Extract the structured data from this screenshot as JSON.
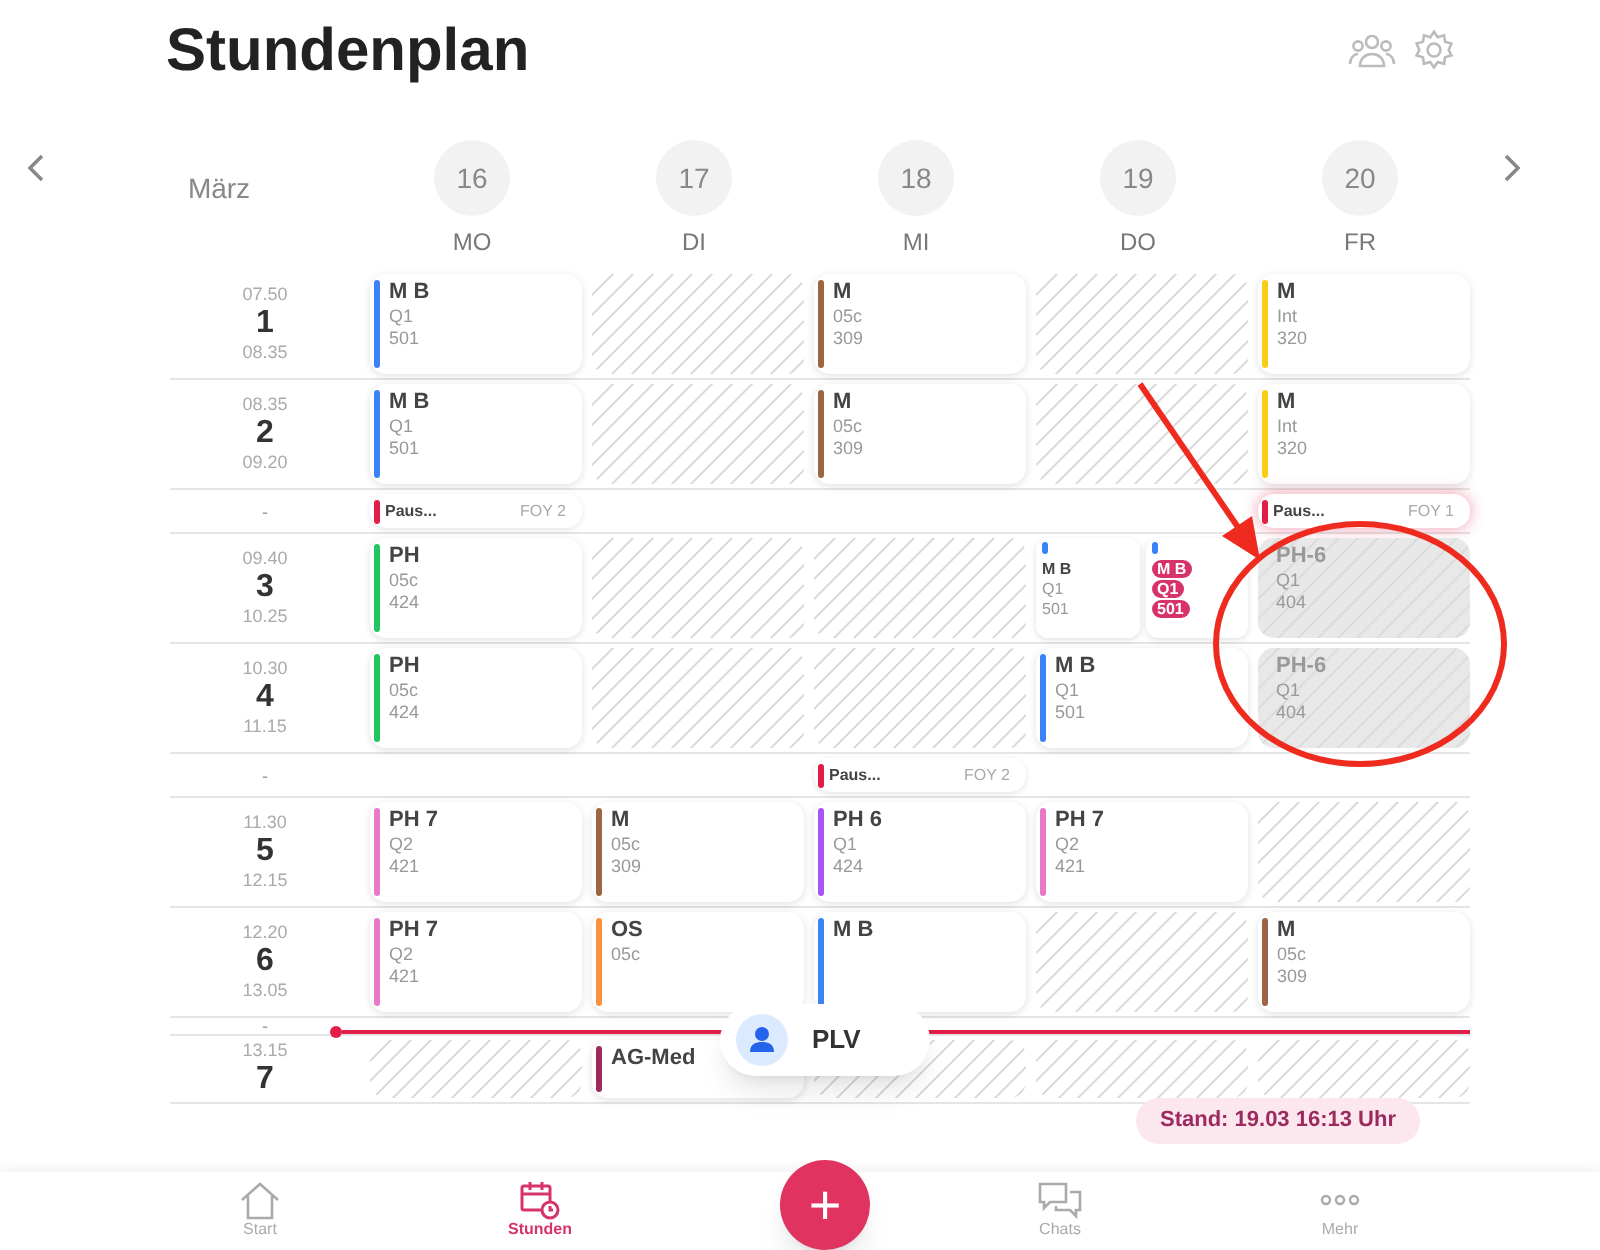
{
  "title": "Stundenplan",
  "month": "März",
  "days": [
    {
      "date": "16",
      "weekday": "MO"
    },
    {
      "date": "17",
      "weekday": "DI"
    },
    {
      "date": "18",
      "weekday": "MI"
    },
    {
      "date": "19",
      "weekday": "DO"
    },
    {
      "date": "20",
      "weekday": "FR"
    }
  ],
  "rows": [
    {
      "kind": "lesson",
      "start": "07.50",
      "number": "1",
      "end": "08.35",
      "cells": [
        {
          "kind": "lesson",
          "subject": "M B",
          "group": "Q1",
          "room": "501",
          "color": "#3b82f6"
        },
        {
          "kind": "free"
        },
        {
          "kind": "lesson",
          "subject": "M",
          "group": "05c",
          "room": "309",
          "color": "#9c6644"
        },
        {
          "kind": "free"
        },
        {
          "kind": "lesson",
          "subject": "M",
          "group": "Int",
          "room": "320",
          "color": "#facc15"
        }
      ]
    },
    {
      "kind": "lesson",
      "start": "08.35",
      "number": "2",
      "end": "09.20",
      "cells": [
        {
          "kind": "lesson",
          "subject": "M B",
          "group": "Q1",
          "room": "501",
          "color": "#3b82f6"
        },
        {
          "kind": "free"
        },
        {
          "kind": "lesson",
          "subject": "M",
          "group": "05c",
          "room": "309",
          "color": "#9c6644"
        },
        {
          "kind": "free"
        },
        {
          "kind": "lesson",
          "subject": "M",
          "group": "Int",
          "room": "320",
          "color": "#facc15"
        }
      ]
    },
    {
      "kind": "pause",
      "label": "-",
      "cells": [
        {
          "kind": "pause",
          "title": "Paus...",
          "room": "FOY 2",
          "color": "#e11d48",
          "highlighted": false
        },
        {
          "kind": "empty"
        },
        {
          "kind": "empty"
        },
        {
          "kind": "empty"
        },
        {
          "kind": "pause",
          "title": "Paus...",
          "room": "FOY 1",
          "color": "#e11d48",
          "highlighted": true
        }
      ]
    },
    {
      "kind": "lesson",
      "start": "09.40",
      "number": "3",
      "end": "10.25",
      "cells": [
        {
          "kind": "lesson",
          "subject": "PH",
          "group": "05c",
          "room": "424",
          "color": "#22c55e"
        },
        {
          "kind": "free"
        },
        {
          "kind": "free"
        },
        {
          "kind": "split",
          "parts": [
            {
              "subject": "M B",
              "group": "Q1",
              "room": "501",
              "color": "#3b82f6",
              "highlighted": false
            },
            {
              "subject": "M B",
              "group": "Q1",
              "room": "501",
              "color": "#3b82f6",
              "highlighted": true
            }
          ]
        },
        {
          "kind": "cancelled",
          "subject": "PH-6",
          "group": "Q1",
          "room": "404"
        }
      ]
    },
    {
      "kind": "lesson",
      "start": "10.30",
      "number": "4",
      "end": "11.15",
      "cells": [
        {
          "kind": "lesson",
          "subject": "PH",
          "group": "05c",
          "room": "424",
          "color": "#22c55e"
        },
        {
          "kind": "free"
        },
        {
          "kind": "free"
        },
        {
          "kind": "lesson",
          "subject": "M B",
          "group": "Q1",
          "room": "501",
          "color": "#3b82f6"
        },
        {
          "kind": "cancelled",
          "subject": "PH-6",
          "group": "Q1",
          "room": "404"
        }
      ]
    },
    {
      "kind": "pause",
      "label": "-",
      "cells": [
        {
          "kind": "empty"
        },
        {
          "kind": "empty"
        },
        {
          "kind": "pause",
          "title": "Paus...",
          "room": "FOY 2",
          "color": "#e11d48",
          "highlighted": false
        },
        {
          "kind": "empty"
        },
        {
          "kind": "empty"
        }
      ]
    },
    {
      "kind": "lesson",
      "start": "11.30",
      "number": "5",
      "end": "12.15",
      "cells": [
        {
          "kind": "lesson",
          "subject": "PH 7",
          "group": "Q2",
          "room": "421",
          "color": "#e879c9"
        },
        {
          "kind": "lesson",
          "subject": "M",
          "group": "05c",
          "room": "309",
          "color": "#9c6644"
        },
        {
          "kind": "lesson",
          "subject": "PH 6",
          "group": "Q1",
          "room": "424",
          "color": "#a855f7"
        },
        {
          "kind": "lesson",
          "subject": "PH 7",
          "group": "Q2",
          "room": "421",
          "color": "#e879c9"
        },
        {
          "kind": "free"
        }
      ]
    },
    {
      "kind": "lesson",
      "start": "12.20",
      "number": "6",
      "end": "13.05",
      "cells": [
        {
          "kind": "lesson",
          "subject": "PH 7",
          "group": "Q2",
          "room": "421",
          "color": "#e879c9"
        },
        {
          "kind": "lesson",
          "subject": "OS",
          "group": "05c",
          "color": "#fb923c"
        },
        {
          "kind": "lesson",
          "subject": "M B",
          "color": "#3b82f6"
        },
        {
          "kind": "free"
        },
        {
          "kind": "lesson",
          "subject": "M",
          "group": "05c",
          "room": "309",
          "color": "#9c6644"
        }
      ]
    },
    {
      "kind": "pause",
      "label": "-",
      "cells": [
        {
          "kind": "empty"
        },
        {
          "kind": "empty"
        },
        {
          "kind": "empty"
        },
        {
          "kind": "empty"
        },
        {
          "kind": "empty"
        }
      ]
    },
    {
      "kind": "lesson",
      "start": "13.15",
      "number": "7",
      "cells": [
        {
          "kind": "free"
        },
        {
          "kind": "lesson",
          "subject": "AG-Med",
          "color": "#9d2a5f"
        },
        {
          "kind": "free"
        },
        {
          "kind": "free"
        },
        {
          "kind": "free"
        }
      ]
    }
  ],
  "current_user": {
    "label": "PLV"
  },
  "status": "Stand: 19.03 16:13 Uhr",
  "nav": [
    {
      "label": "Start",
      "selected": false
    },
    {
      "label": "Stunden",
      "selected": true
    },
    {
      "label": "Chats",
      "selected": false
    },
    {
      "label": "Mehr",
      "selected": false
    }
  ],
  "add_button": {
    "label": "+"
  }
}
